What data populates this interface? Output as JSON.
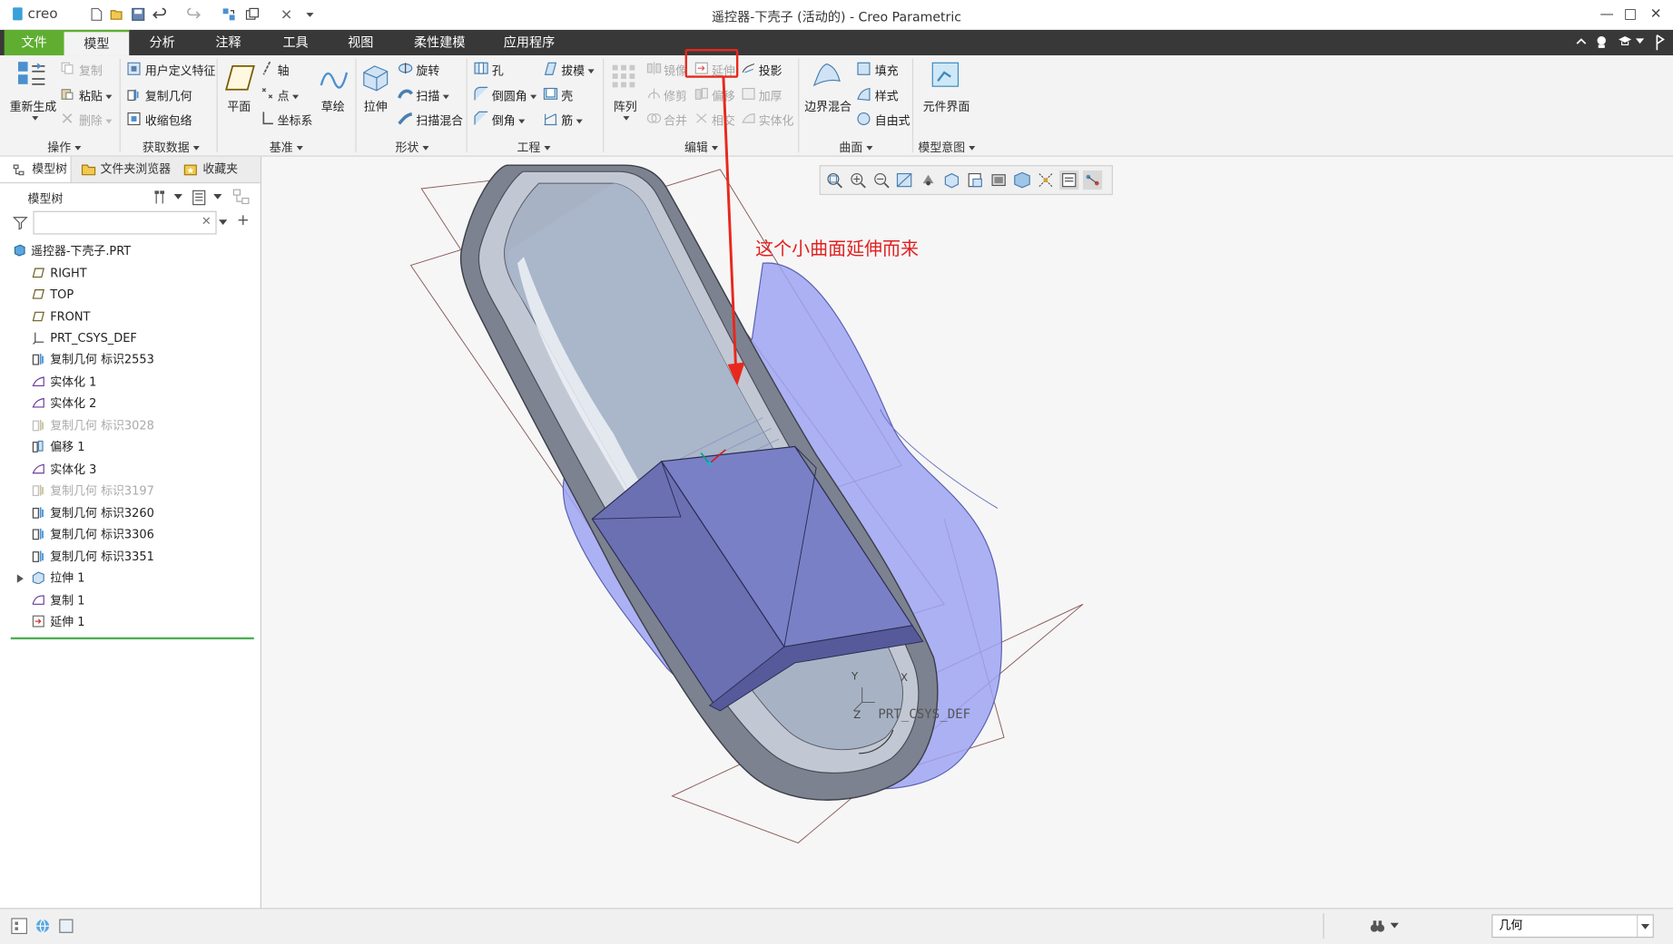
{
  "app": {
    "logo_text": "creo",
    "window_title": "遥控器-下壳子 (活动的) - Creo Parametric"
  },
  "menu": {
    "items": [
      "文件",
      "模型",
      "分析",
      "注释",
      "工具",
      "视图",
      "柔性建模",
      "应用程序"
    ],
    "active": "模型"
  },
  "ribbon": {
    "operations": {
      "regenerate": "重新生成",
      "copy": "复制",
      "paste": "粘贴",
      "delete": "删除",
      "group": "操作"
    },
    "get_data": {
      "udf": "用户定义特征",
      "copy_geometry": "复制几何",
      "shrinkwrap": "收缩包络",
      "group": "获取数据"
    },
    "datum": {
      "plane": "平面",
      "axis": "轴",
      "point": "点",
      "csys": "坐标系",
      "sketch": "草绘",
      "group": "基准"
    },
    "shapes": {
      "extrude": "拉伸",
      "revolve": "旋转",
      "sweep": "扫描",
      "swept_blend": "扫描混合",
      "group": "形状"
    },
    "engineering": {
      "hole": "孔",
      "draft": "拔模",
      "round": "倒圆角",
      "shell": "壳",
      "chamfer": "倒角",
      "rib": "筋",
      "group": "工程"
    },
    "editing": {
      "pattern": "阵列",
      "mirror": "镜像",
      "extend": "延伸",
      "project": "投影",
      "trim": "修剪",
      "offset": "偏移",
      "thicken": "加厚",
      "merge": "合并",
      "intersect": "相交",
      "solidify": "实体化",
      "group": "编辑"
    },
    "surfaces": {
      "boundary_blend": "边界混合",
      "fill": "填充",
      "style": "样式",
      "freestyle": "自由式",
      "group": "曲面"
    },
    "model_intent": {
      "component_interface": "元件界面",
      "group": "模型意图"
    }
  },
  "panel": {
    "tabs": [
      "模型树",
      "文件夹浏览器",
      "收藏夹"
    ],
    "tree_header": "模型树",
    "search_placeholder": "",
    "tree_items": [
      {
        "label": "遥控器-下壳子.PRT",
        "icon": "part-icon",
        "disabled": false
      },
      {
        "label": "RIGHT",
        "icon": "datum-plane-icon",
        "disabled": false
      },
      {
        "label": "TOP",
        "icon": "datum-plane-icon",
        "disabled": false
      },
      {
        "label": "FRONT",
        "icon": "datum-plane-icon",
        "disabled": false
      },
      {
        "label": "PRT_CSYS_DEF",
        "icon": "csys-icon",
        "disabled": false
      },
      {
        "label": "复制几何 标识2553",
        "icon": "copy-geometry-icon",
        "disabled": false
      },
      {
        "label": "实体化 1",
        "icon": "solidify-icon",
        "disabled": false
      },
      {
        "label": "实体化 2",
        "icon": "solidify-icon",
        "disabled": false
      },
      {
        "label": "复制几何 标识3028",
        "icon": "copy-geometry-icon",
        "disabled": true
      },
      {
        "label": "偏移 1",
        "icon": "offset-icon",
        "disabled": false
      },
      {
        "label": "实体化 3",
        "icon": "solidify-icon",
        "disabled": false
      },
      {
        "label": "复制几何 标识3197",
        "icon": "copy-geometry-icon",
        "disabled": true
      },
      {
        "label": "复制几何 标识3260",
        "icon": "copy-geometry-icon",
        "disabled": false
      },
      {
        "label": "复制几何 标识3306",
        "icon": "copy-geometry-icon",
        "disabled": false
      },
      {
        "label": "复制几何 标识3351",
        "icon": "copy-geometry-icon",
        "disabled": false
      },
      {
        "label": "拉伸 1",
        "icon": "extrude-icon",
        "disabled": false
      },
      {
        "label": "复制 1",
        "icon": "copy-surface-icon",
        "disabled": false
      },
      {
        "label": "延伸 1",
        "icon": "extend-icon",
        "disabled": false
      }
    ]
  },
  "viewport": {
    "annotation": "这个小曲面延伸而来",
    "csys_label": "PRT_CSYS_DEF",
    "axis_y": "Y",
    "axis_x": "X",
    "axis_z": "Z"
  },
  "status": {
    "filter_value": "几何"
  },
  "colors": {
    "file_tab": "#5fae31",
    "menubar": "#383838",
    "annotation": "#e02020",
    "surface_blue": "#9ea4f2",
    "solid_box": "#6d72b8"
  }
}
